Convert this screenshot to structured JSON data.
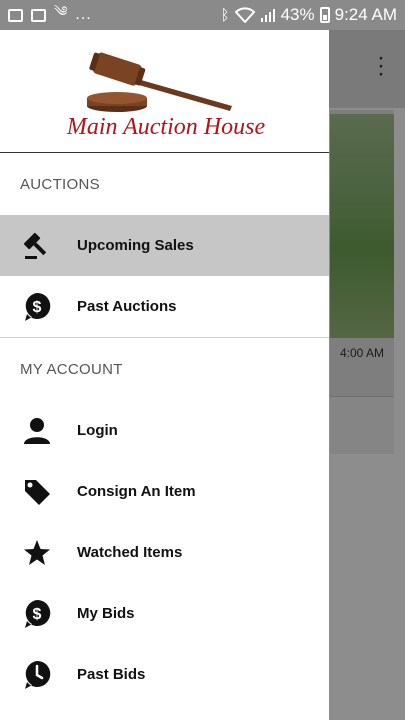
{
  "status_bar": {
    "dots": "...",
    "battery": "43%",
    "time": "9:24 AM"
  },
  "logo": {
    "text": "Main Auction House"
  },
  "sections": {
    "auctions": {
      "title": "AUCTIONS",
      "items": [
        {
          "label": "Upcoming Sales",
          "icon": "gavel-icon",
          "active": true
        },
        {
          "label": "Past Auctions",
          "icon": "dollar-pin-icon"
        }
      ]
    },
    "account": {
      "title": "MY ACCOUNT",
      "items": [
        {
          "label": "Login",
          "icon": "person-icon"
        },
        {
          "label": "Consign An Item",
          "icon": "tag-icon"
        },
        {
          "label": "Watched Items",
          "icon": "star-icon"
        },
        {
          "label": "My Bids",
          "icon": "dollar-pin-icon"
        },
        {
          "label": "Past Bids",
          "icon": "clock-pin-icon"
        }
      ]
    }
  },
  "background": {
    "time_label": "4:00 AM"
  },
  "colors": {
    "logo_red": "#b5121b",
    "gavel_brown": "#6b3a1e",
    "active_bg": "#c6c6c6",
    "scrim": "#8d8d8d"
  }
}
